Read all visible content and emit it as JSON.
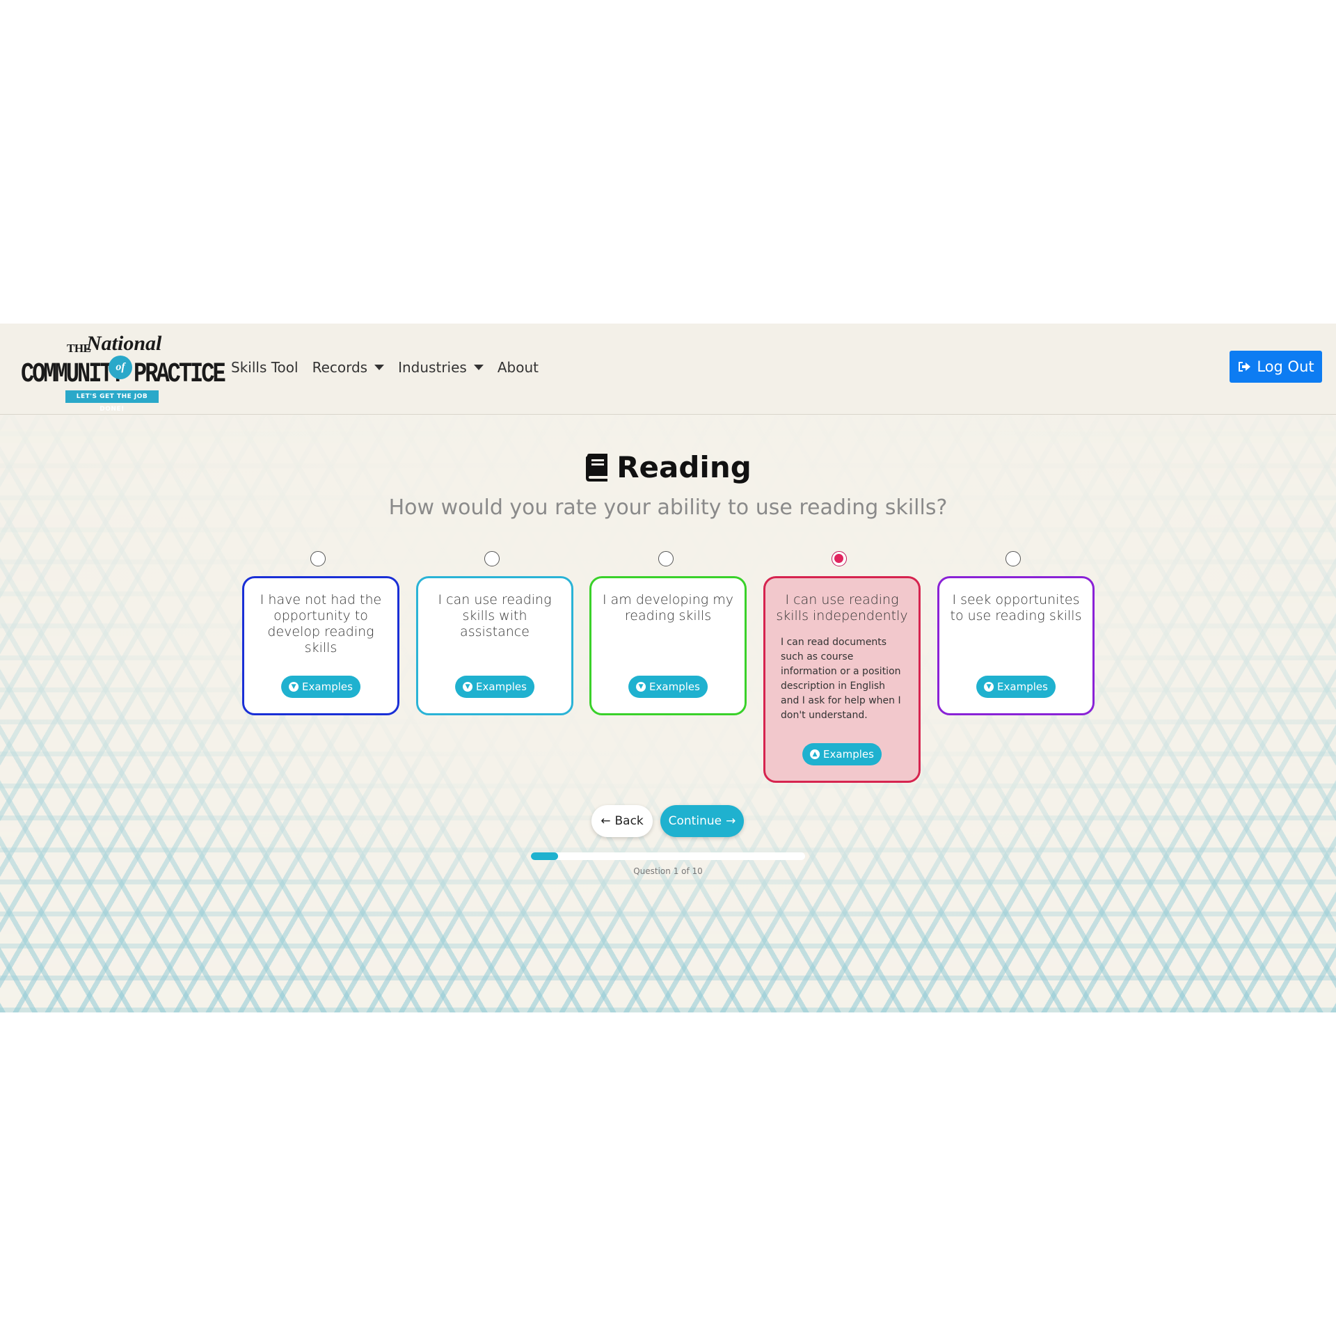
{
  "logo": {
    "the": "THE",
    "national": "National",
    "community_practice": "COMMUNITY PRACTICE",
    "of": "of",
    "tagline": "LET'S GET THE JOB DONE!"
  },
  "nav": {
    "items": [
      {
        "label": "Skills Tool",
        "dropdown": false
      },
      {
        "label": "Records",
        "dropdown": true
      },
      {
        "label": "Industries",
        "dropdown": true
      },
      {
        "label": "About",
        "dropdown": false
      }
    ],
    "logout_label": "Log Out"
  },
  "question": {
    "icon": "book-icon",
    "title": "Reading",
    "subtitle": "How would you rate your ability to use reading skills?"
  },
  "options": [
    {
      "label": "I have not had the opportunity to develop reading skills",
      "border_color": "#1a2fd6",
      "selected": false,
      "expanded": false,
      "description": "",
      "examples_label": "Examples"
    },
    {
      "label": "I can use reading skills with assistance",
      "border_color": "#2ab3d6",
      "selected": false,
      "expanded": false,
      "description": "",
      "examples_label": "Examples"
    },
    {
      "label": "I am developing my reading skills",
      "border_color": "#3ad12a",
      "selected": false,
      "expanded": false,
      "description": "",
      "examples_label": "Examples"
    },
    {
      "label": "I can use reading skills independently",
      "border_color": "#d6244f",
      "selected": true,
      "expanded": true,
      "description": "I can read documents such as course information or a position description in English and I ask for help when I don't understand.",
      "examples_label": "Examples"
    },
    {
      "label": "I seek opportunites to use reading skills",
      "border_color": "#8a22d6",
      "selected": false,
      "expanded": false,
      "description": "",
      "examples_label": "Examples"
    }
  ],
  "colors": {
    "selected_card_bg": "#f2c8cc",
    "accent": "#1fb1cf",
    "logout": "#0d7cf2"
  },
  "actions": {
    "back_label": "Back",
    "continue_label": "Continue"
  },
  "progress": {
    "current": 1,
    "total": 10,
    "label": "Question 1 of 10"
  }
}
